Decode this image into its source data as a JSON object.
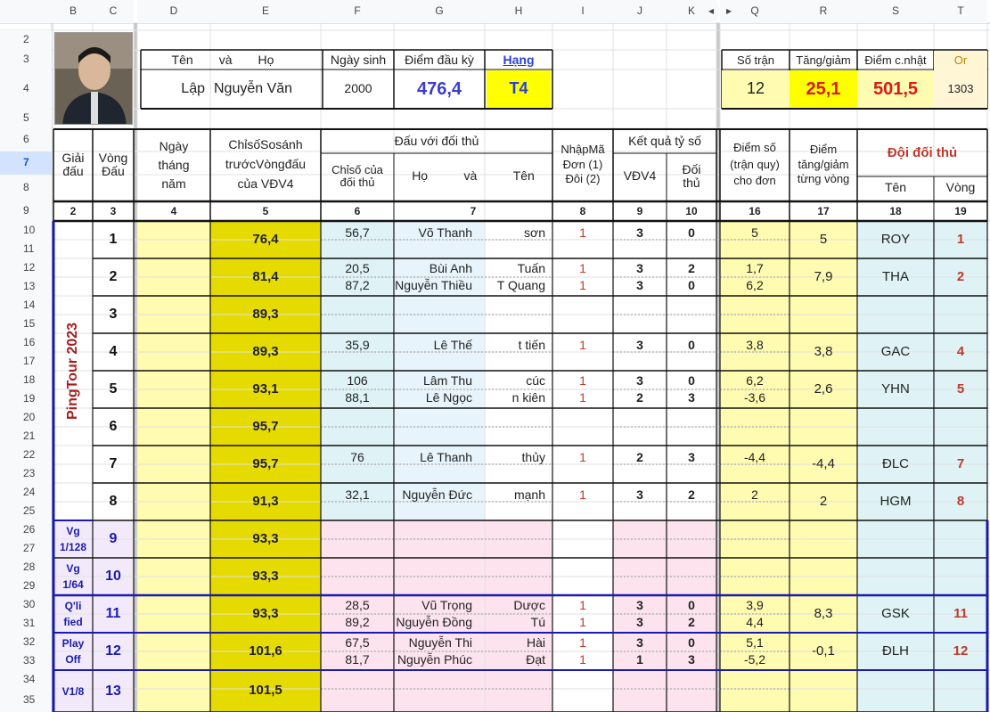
{
  "columns": [
    "B",
    "C",
    "D",
    "E",
    "F",
    "G",
    "H",
    "I",
    "J",
    "K",
    "Q",
    "R",
    "S",
    "T"
  ],
  "rows": [
    "2",
    "3",
    "4",
    "5",
    "6",
    "7",
    "8",
    "9",
    "10",
    "11",
    "12",
    "13",
    "14",
    "15",
    "16",
    "17",
    "18",
    "19",
    "20",
    "21",
    "22",
    "23",
    "24",
    "25",
    "26",
    "27",
    "28",
    "29",
    "30",
    "31",
    "32",
    "33",
    "34",
    "35"
  ],
  "player": {
    "photo_label": "",
    "name_label": "Tên và Họ",
    "name_label_parts": [
      "Tên",
      "và",
      "Họ"
    ],
    "first_name": "Lập",
    "last_name": "Nguyễn Văn",
    "dob_label": "Ngày sinh",
    "dob": "2000",
    "start_score_label": "Điểm đầu kỳ",
    "start_score": "476,4",
    "rank_label": "Hạng",
    "rank": "T4"
  },
  "summary": {
    "matches_label": "Số trận",
    "matches": "12",
    "change_label": "Tăng/giảm",
    "change": "25,1",
    "updated_label": "Điểm c.nhật",
    "updated": "501,5",
    "or_label": "Or",
    "or_value": "1303"
  },
  "table_header": {
    "tournament": "Giải\nđấu",
    "round": "Vòng\nĐấu",
    "date": "Ngày\ntháng\nnăm",
    "index": "ChỉsốSosánh\ntrướcVòngđấu\ncủa VĐV4",
    "vs_opponent": "Đấu với đối thủ",
    "opp_index": "Chỉsố của\nđối thủ",
    "opp_name_parts": [
      "Họ",
      "và",
      "Tên"
    ],
    "code": "NhậpMã\nĐơn (1)\nĐôi (2)",
    "result": "Kết quả tỷ số",
    "vdv4": "VĐV4",
    "opp": "Đối\nthủ",
    "points": "Điểm số\n(trận quy)\ncho đơn",
    "delta": "Điểm\ntăng/giảm\ntừng vòng",
    "team": "Đội đối thủ",
    "team_name": "Tên",
    "team_round": "Vòng"
  },
  "col_numbers": [
    "2",
    "3",
    "4",
    "5",
    "6",
    "7",
    "8",
    "9",
    "10",
    "16",
    "17",
    "18",
    "19"
  ],
  "tournament_label": "PingTour 2023",
  "rounds": [
    {
      "round": "1",
      "stage": "",
      "index": "76,4",
      "matches": [
        {
          "opp_index": "56,7",
          "last": "Võ Thanh",
          "first": "sơn",
          "code": "1",
          "a": "3",
          "b": "0",
          "pts": "5"
        }
      ],
      "delta": "5",
      "team": "ROY",
      "team_round": "1"
    },
    {
      "round": "2",
      "stage": "",
      "index": "81,4",
      "matches": [
        {
          "opp_index": "20,5",
          "last": "Bùi Anh",
          "first": "Tuấn",
          "code": "1",
          "a": "3",
          "b": "2",
          "pts": "1,7"
        },
        {
          "opp_index": "87,2",
          "last": "Nguyễn Thiều",
          "first": "T Quang",
          "code": "1",
          "a": "3",
          "b": "0",
          "pts": "6,2"
        }
      ],
      "delta": "7,9",
      "team": "THA",
      "team_round": "2"
    },
    {
      "round": "3",
      "stage": "",
      "index": "89,3",
      "matches": [],
      "delta": "",
      "team": "",
      "team_round": ""
    },
    {
      "round": "4",
      "stage": "",
      "index": "89,3",
      "matches": [
        {
          "opp_index": "35,9",
          "last": "Lê Thế",
          "first": "t tiến",
          "code": "1",
          "a": "3",
          "b": "0",
          "pts": "3,8"
        }
      ],
      "delta": "3,8",
      "team": "GAC",
      "team_round": "4"
    },
    {
      "round": "5",
      "stage": "",
      "index": "93,1",
      "matches": [
        {
          "opp_index": "106",
          "last": "Lâm Thu",
          "first": "cúc",
          "code": "1",
          "a": "3",
          "b": "0",
          "pts": "6,2"
        },
        {
          "opp_index": "88,1",
          "last": "Lê Ngọc",
          "first": "n kiên",
          "code": "1",
          "a": "2",
          "b": "3",
          "pts": "-3,6"
        }
      ],
      "delta": "2,6",
      "team": "YHN",
      "team_round": "5"
    },
    {
      "round": "6",
      "stage": "",
      "index": "95,7",
      "matches": [],
      "delta": "",
      "team": "",
      "team_round": ""
    },
    {
      "round": "7",
      "stage": "",
      "index": "95,7",
      "matches": [
        {
          "opp_index": "76",
          "last": "Lê Thanh",
          "first": "thủy",
          "code": "1",
          "a": "2",
          "b": "3",
          "pts": "-4,4"
        }
      ],
      "delta": "-4,4",
      "team": "ĐLC",
      "team_round": "7"
    },
    {
      "round": "8",
      "stage": "",
      "index": "91,3",
      "matches": [
        {
          "opp_index": "32,1",
          "last": "Nguyễn Đức",
          "first": "mạnh",
          "code": "1",
          "a": "3",
          "b": "2",
          "pts": "2"
        }
      ],
      "delta": "2",
      "team": "HGM",
      "team_round": "8"
    },
    {
      "round": "9",
      "stage": "Vg\n1/128",
      "index": "93,3",
      "matches": [],
      "delta": "",
      "team": "",
      "team_round": ""
    },
    {
      "round": "10",
      "stage": "Vg\n1/64",
      "index": "93,3",
      "matches": [],
      "delta": "",
      "team": "",
      "team_round": ""
    },
    {
      "round": "11",
      "stage": "Q'li\nfied",
      "index": "93,3",
      "matches": [
        {
          "opp_index": "28,5",
          "last": "Vũ Trọng",
          "first": "Dược",
          "code": "1",
          "a": "3",
          "b": "0",
          "pts": "3,9"
        },
        {
          "opp_index": "89,2",
          "last": "Nguyễn Đồng",
          "first": "Tú",
          "code": "1",
          "a": "3",
          "b": "2",
          "pts": "4,4"
        }
      ],
      "delta": "8,3",
      "team": "GSK",
      "team_round": "11"
    },
    {
      "round": "12",
      "stage": "Play\nOff",
      "index": "101,6",
      "matches": [
        {
          "opp_index": "67,5",
          "last": "Nguyễn Thi",
          "first": "Hài",
          "code": "1",
          "a": "3",
          "b": "0",
          "pts": "5,1"
        },
        {
          "opp_index": "81,7",
          "last": "Nguyễn Phúc",
          "first": "Đạt",
          "code": "1",
          "a": "1",
          "b": "3",
          "pts": "-5,2"
        }
      ],
      "delta": "-0,1",
      "team": "ĐLH",
      "team_round": "12"
    },
    {
      "round": "13",
      "stage": "V1/8",
      "index": "101,5",
      "matches": [],
      "delta": "",
      "team": "",
      "team_round": ""
    }
  ],
  "colors": {
    "yellow": "#fffbb0",
    "olive": "#e6db00",
    "cyan": "#dff3f6",
    "pink": "#fde3ee",
    "lavender": "#f2eafa",
    "red": "#c0392b",
    "blue": "#3b3bd6",
    "navy": "#1a1ab0",
    "rank_yellow": "#ffff00"
  }
}
